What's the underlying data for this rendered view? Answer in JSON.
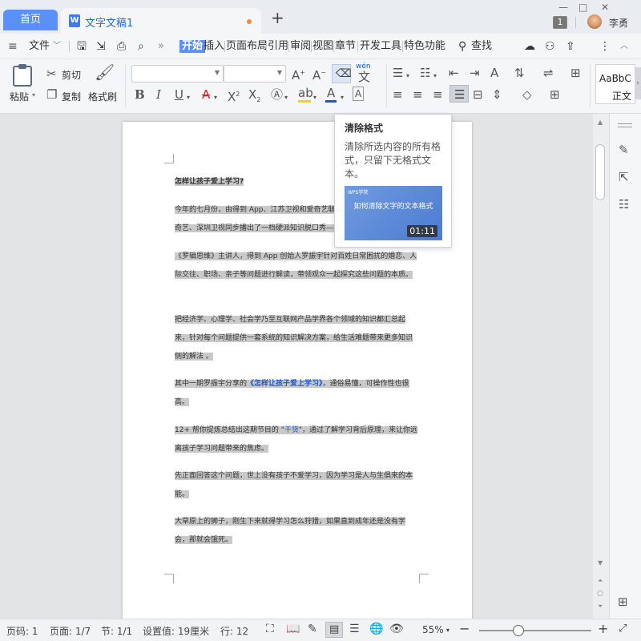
{
  "titlebar": {
    "home_tab": "首页",
    "doc_tab": "文字文稿1",
    "new_tab": "+",
    "badge": "1",
    "user_name": "李勇",
    "win_min": "—",
    "win_max": "□",
    "win_close": "✕"
  },
  "menu": {
    "file": "文件",
    "tabs": [
      "开始",
      "插入",
      "页面布局",
      "引用",
      "审阅",
      "视图",
      "章节",
      "开发工具",
      "特色功能"
    ],
    "search": "查找"
  },
  "ribbon": {
    "paste": "粘贴",
    "cut": "剪切",
    "copy": "复制",
    "format_painter": "格式刷",
    "font_name": "",
    "font_size": "",
    "style_preview": "AaBbC",
    "style_name": "正文",
    "pinyin": "wén"
  },
  "document": {
    "title": "怎样让孩子爱上学习?",
    "p1": "今年的七月份，由得到 App、江苏卫视和爱奇艺联合出品，在得到 App、爱奇艺、深圳卫视同步播出了一档硬派知识脱口秀——《小孩",
    "p2": "《罗辑思维》主讲人，得到 App 创始人罗振宇针对百姓日常困扰的婚恋、人际交往、职场、亲子等问题进行解读，带领观众一起探究这些问题的本质。",
    "p3": "把经济学、心理学、社会学乃至互联网产品学界各个领域的知识都汇总起来，针对每个问题提供一套系统的知识解决方案，给生活难题带来更多知识侧的解法 。",
    "p4_pre": "其中一期罗振宇分享的",
    "p4_link": "《怎样让孩子爱上学习》",
    "p4_post": "，通俗易懂，可操作性也很高。",
    "p5_pre": "12+ 帮你提炼总结出这期节目的 \"",
    "p5_link": "干货",
    "p5_post": "\"，通过了解学习背后原理，来让你远离孩子学习问题带来的焦虑。",
    "p6": "先正面回答这个问题，世上没有孩子不爱学习，因为学习是人与生俱来的本能。",
    "p7": "大草原上的狮子，刚生下来就得学习怎么狩猎，如果直到成年还是没有学会，那就会饿死。"
  },
  "tooltip": {
    "title": "清除格式",
    "desc": "清除所选内容的所有格式，只留下无格式文本。",
    "video_brand": "WPS学院",
    "video_title": "如何清除文字的文本格式",
    "video_duration": "01:11"
  },
  "status": {
    "page_code": "页码: 1",
    "page": "页面: 1/7",
    "section": "节: 1/1",
    "setting": "设置值: 19厘米",
    "line": "行: 12",
    "zoom": "55%",
    "zoom_level": 0.35
  },
  "colors": {
    "accent": "#5b8ff9",
    "doc_title": "#2b68d9",
    "highlight": "#c9c9c9",
    "link": "#1a57c9",
    "modified_dot": "#f38b3c",
    "font_color_bar": "#1a57c9",
    "highlight_bar": "#f5d400"
  }
}
